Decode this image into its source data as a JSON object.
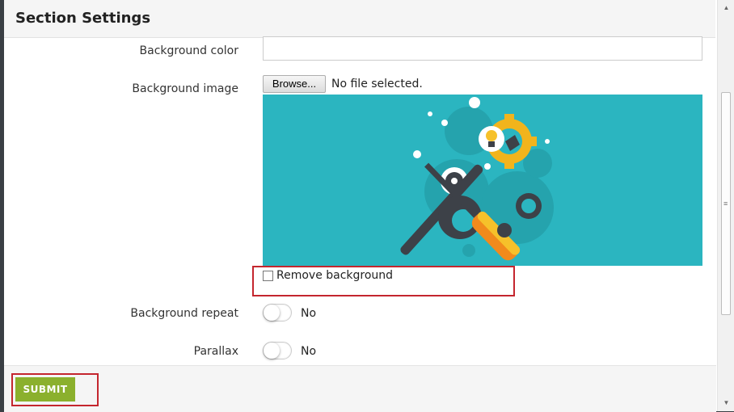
{
  "modal": {
    "title": "Section Settings"
  },
  "fields": {
    "background_color": {
      "label": "Background color",
      "value": ""
    },
    "background_image": {
      "label": "Background image",
      "browse_label": "Browse...",
      "file_status": "No file selected.",
      "preview_icon": "wrench-screwdriver-gears-illustration"
    },
    "remove_background": {
      "label": "Remove background",
      "checked": false
    },
    "background_repeat": {
      "label": "Background repeat",
      "value": "No"
    },
    "parallax": {
      "label": "Parallax",
      "value": "No"
    }
  },
  "footer": {
    "submit_label": "SUBMIT"
  },
  "colors": {
    "accent_green": "#8bb02d",
    "highlight_red": "#c4262e",
    "preview_teal": "#2bb5c0"
  }
}
